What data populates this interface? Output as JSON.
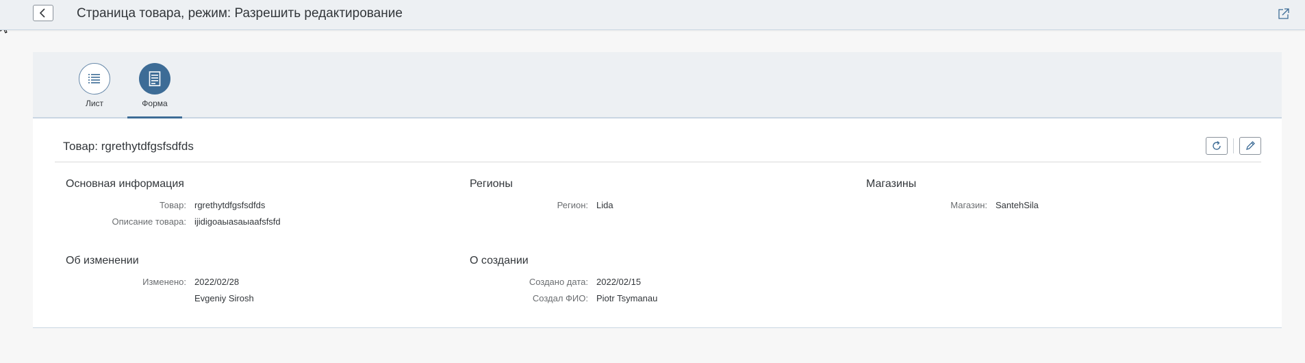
{
  "header": {
    "title": "Страница товара, режим: Разрешить редактирование",
    "back_icon": "chevron-left-icon",
    "share_icon": "share-icon"
  },
  "tabs": [
    {
      "label": "Лист",
      "icon": "list-icon",
      "selected": false
    },
    {
      "label": "Форма",
      "icon": "form-icon",
      "selected": true
    }
  ],
  "form": {
    "title": "Товар: rgrethytdfgsfsdfds",
    "toolbar": {
      "refresh_icon": "refresh-icon",
      "edit_icon": "edit-pencil-icon"
    },
    "sections": {
      "main_info": {
        "title": "Основная информация",
        "product_label": "Товар:",
        "product_value": "rgrethytdfgsfsdfds",
        "description_label": "Описание товара:",
        "description_value": "ijidigoaыasaыaafsfsfd"
      },
      "regions": {
        "title": "Регионы",
        "region_label": "Регион:",
        "region_value": "Lida"
      },
      "stores": {
        "title": "Магазины",
        "store_label": "Магазин:",
        "store_value": "SantehSila"
      },
      "change_info": {
        "title": "Об изменении",
        "changed_label": "Изменено:",
        "changed_date": "2022/02/28",
        "changed_by": "Evgeniy Sirosh"
      },
      "creation_info": {
        "title": "О создании",
        "created_date_label": "Создано дата:",
        "created_date_value": "2022/02/15",
        "created_by_label": "Создал ФИО:",
        "created_by_value": "Piotr Tsymanau"
      }
    }
  },
  "colors": {
    "header_bg": "#edf0f3",
    "accent": "#3d6c96",
    "panel_bg": "#ffffff",
    "page_bg": "#f7f7f7"
  }
}
